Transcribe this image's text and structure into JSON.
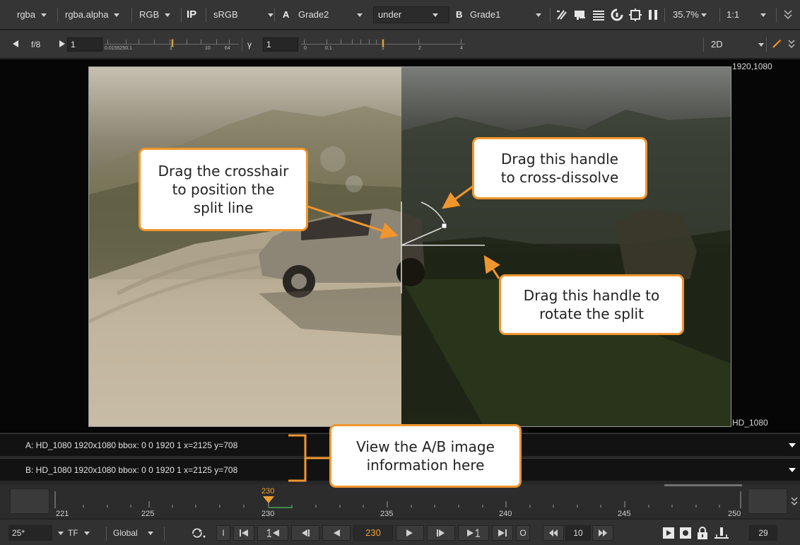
{
  "toolbar1": {
    "channels": "rgba",
    "alpha_channel": "rgba.alpha",
    "display_mode": "RGB",
    "ip_label": "IP",
    "colorspace": "sRGB",
    "a_letter": "A",
    "a_input": "Grade2",
    "composite_mode": "under",
    "b_letter": "B",
    "b_input": "Grade1",
    "zoom": "35.7%",
    "ratio": "1:1"
  },
  "toolbar2": {
    "fstop": "f/8",
    "gain_value": "1",
    "gain_ticks": [
      "0.0155250.1",
      "1",
      "10",
      "64"
    ],
    "gamma_label": "γ",
    "gamma_value": "1",
    "gamma_ticks": [
      "0",
      "0.1",
      "1",
      "2",
      "4"
    ],
    "view_mode": "2D"
  },
  "viewer": {
    "format_top_right": "1920,1080",
    "format_bottom_right": "HD_1080"
  },
  "callouts": {
    "crosshair": [
      "Drag the crosshair",
      "to position the",
      "split line"
    ],
    "dissolve": [
      "Drag this handle",
      "to cross-dissolve"
    ],
    "rotate": [
      "Drag this handle to",
      "rotate the split"
    ],
    "info": [
      "View the A/B image",
      "information here"
    ]
  },
  "info": {
    "a_line": "A:  HD_1080 1920x1080  bbox: 0 0 1920 1  x=2125 y=708",
    "b_line": "B:  HD_1080 1920x1080  bbox: 0 0 1920 1  x=2125 y=708"
  },
  "timeline": {
    "current_marker": "230",
    "labels": [
      "221",
      "225",
      "230",
      "235",
      "240",
      "245",
      "250"
    ]
  },
  "playback": {
    "fps": "25*",
    "tf": "TF",
    "scope": "Global",
    "in_label": "I",
    "current_frame": "230",
    "out_label": "O",
    "step": "10",
    "end_frame": "29"
  },
  "colors": {
    "accent_orange": "#f0962e",
    "current_frame": "#f0a030"
  }
}
